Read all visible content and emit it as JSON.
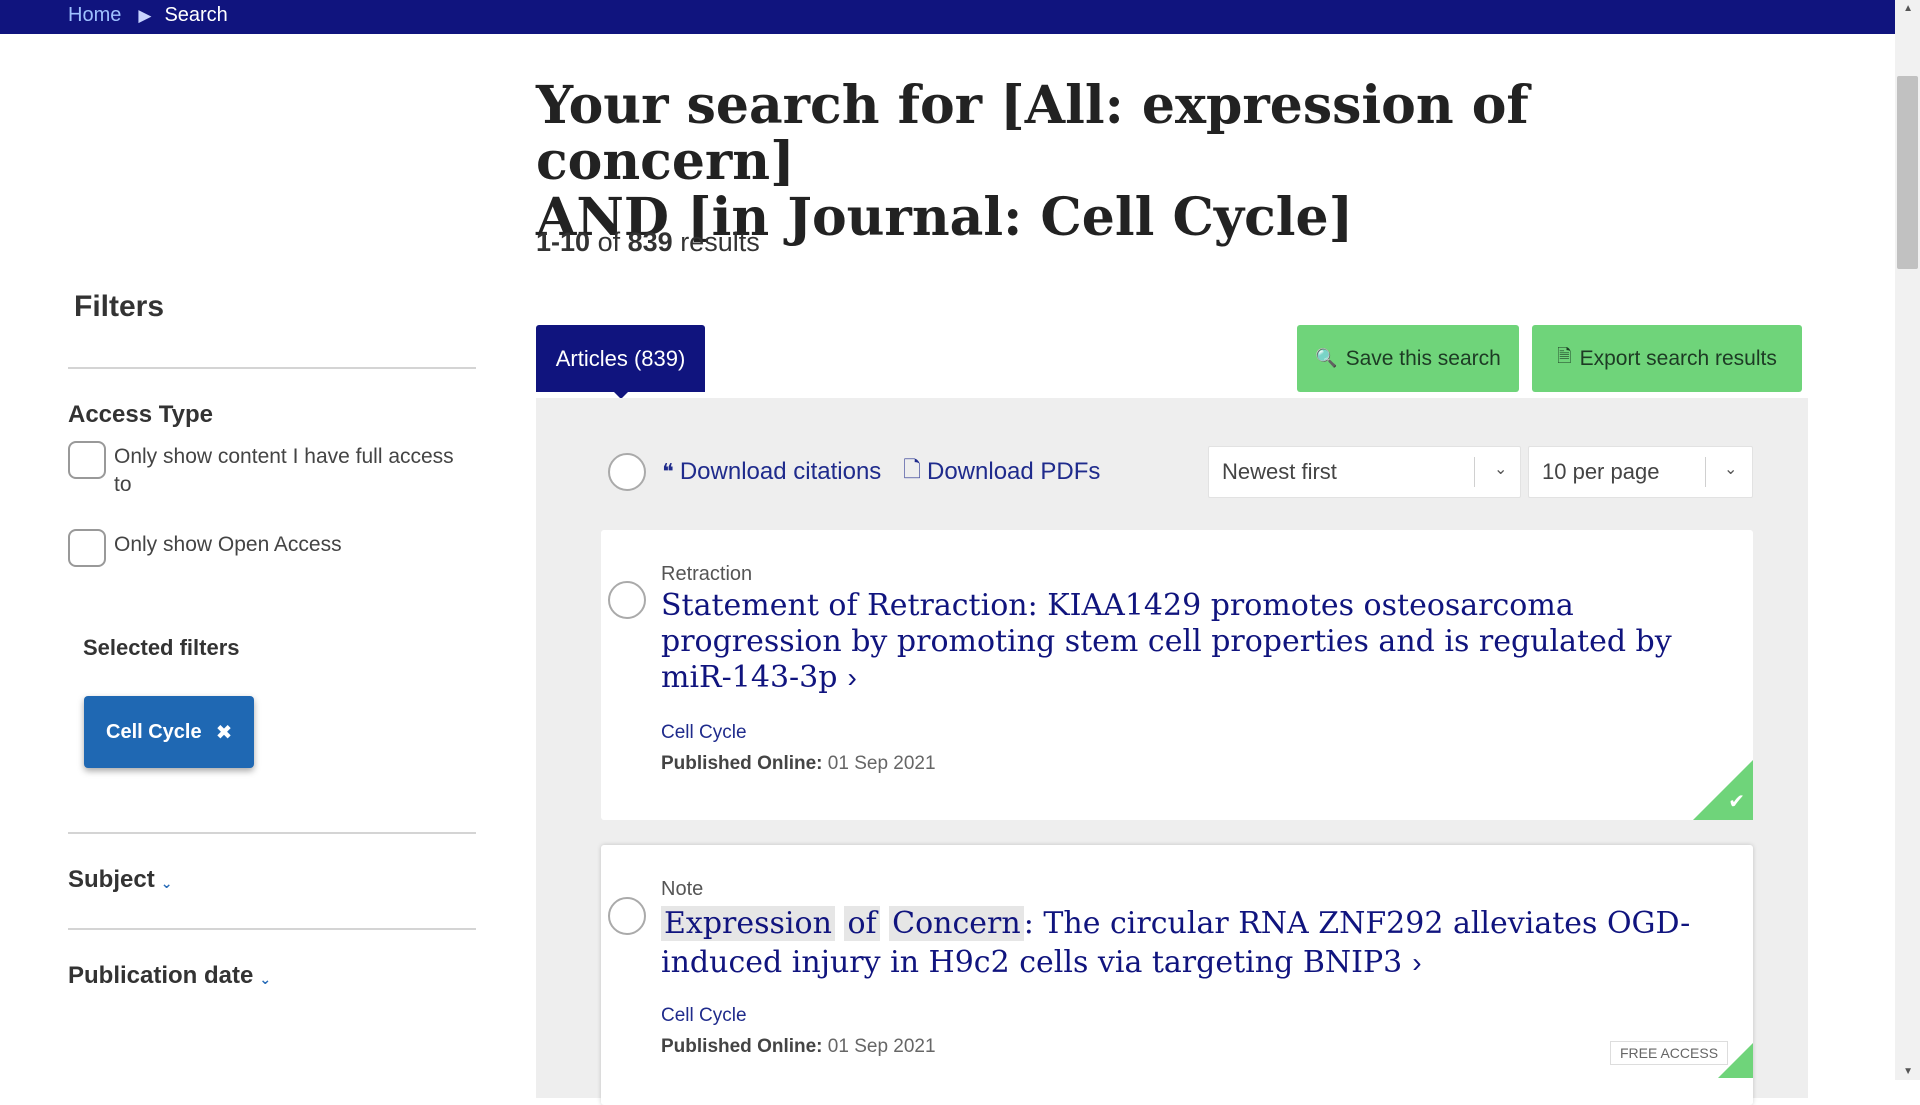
{
  "breadcrumb": {
    "home": "Home",
    "separator": "▶",
    "current": "Search"
  },
  "headline": {
    "prefix": "Your search for ",
    "query_line1": "[All: expression of concern]",
    "query_line2": "AND [in Journal: Cell Cycle]"
  },
  "results": {
    "range": "1-10",
    "of": "of",
    "total": "839",
    "suffix": "results"
  },
  "sidebar": {
    "filters_title": "Filters",
    "access_type": {
      "title": "Access Type",
      "options": [
        {
          "label": "Only show content I have full access to",
          "checked": false
        },
        {
          "label": "Only show Open Access",
          "checked": false
        }
      ]
    },
    "selected_filters": {
      "title": "Selected filters",
      "chips": [
        {
          "label": "Cell Cycle",
          "remove_icon": "✖"
        }
      ]
    },
    "facets": [
      {
        "label": "Subject",
        "icon": "chevron-down-icon"
      },
      {
        "label": "Publication date",
        "icon": "chevron-down-icon"
      }
    ]
  },
  "tabs": [
    {
      "label": "Articles (839)",
      "active": true
    }
  ],
  "actions": {
    "save_search": "Save this search",
    "export_results": "Export search results"
  },
  "toolbar": {
    "download_citations": "Download citations",
    "download_pdfs": "Download PDFs",
    "sort": {
      "selected": "Newest first"
    },
    "per_page": {
      "selected": "10 per page"
    }
  },
  "articles": [
    {
      "type": "Retraction",
      "title": "Statement of Retraction: KIAA1429 promotes osteosarcoma progression by promoting stem cell properties and is regulated by miR-143-3p",
      "journal": "Cell Cycle",
      "published_label": "Published Online:",
      "published_date": "01 Sep 2021",
      "access_badge": "",
      "access_icon": "check-icon"
    },
    {
      "type": "Note",
      "title_highlights": [
        "Expression",
        "of",
        "Concern"
      ],
      "title_rest": ": The circular RNA ZNF292 alleviates OGD-induced injury in H9c2 cells via targeting BNIP3",
      "journal": "Cell Cycle",
      "published_label": "Published Online:",
      "published_date": "01 Sep 2021",
      "access_badge": "FREE ACCESS",
      "access_icon": "check-icon"
    }
  ],
  "colors": {
    "navy": "#10147e",
    "green": "#6fd47a",
    "chip_blue": "#1f68b3",
    "panel_gray": "#eeeeee"
  }
}
